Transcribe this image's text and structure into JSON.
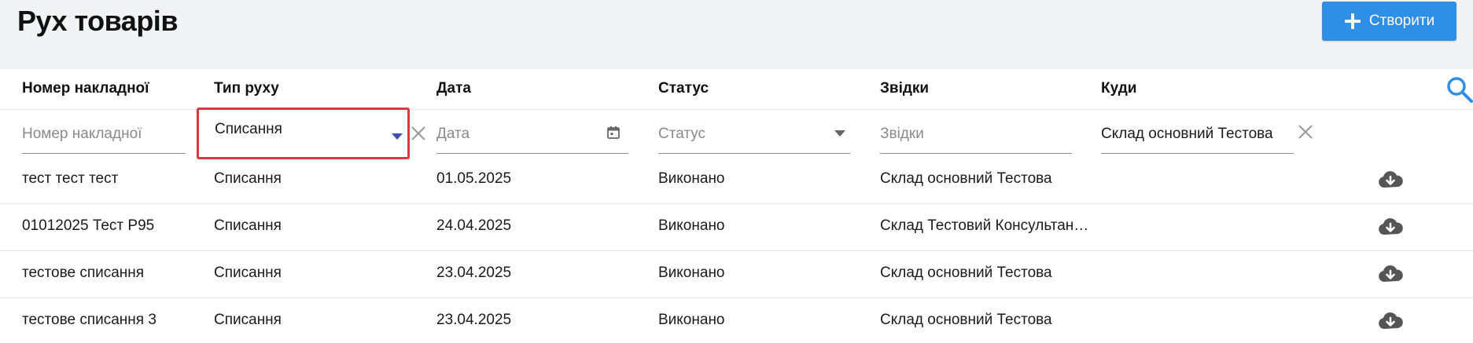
{
  "header": {
    "title": "Рух товарів",
    "create_label": "Створити"
  },
  "columns": [
    "Номер накладної",
    "Тип руху",
    "Дата",
    "Статус",
    "Звідки",
    "Куди"
  ],
  "filters": {
    "number_placeholder": "Номер накладної",
    "type_value": "Списання",
    "date_placeholder": "Дата",
    "status_placeholder": "Статус",
    "from_placeholder": "Звідки",
    "to_value": "Склад основний Тестова"
  },
  "rows": [
    {
      "number": "тест тест тест",
      "type": "Списання",
      "date": "01.05.2025",
      "status": "Виконано",
      "from": "Склад основний Тестова",
      "to": ""
    },
    {
      "number": "01012025 Тест Р95",
      "type": "Списання",
      "date": "24.04.2025",
      "status": "Виконано",
      "from": "Склад Тестовий Консультан…",
      "to": ""
    },
    {
      "number": "тестове списання",
      "type": "Списання",
      "date": "23.04.2025",
      "status": "Виконано",
      "from": "Склад основний Тестова",
      "to": ""
    },
    {
      "number": "тестове списання 3",
      "type": "Списання",
      "date": "23.04.2025",
      "status": "Виконано",
      "from": "Склад основний Тестова",
      "to": ""
    }
  ],
  "colors": {
    "accent": "#2f8ee5",
    "highlight_border": "#d9393f",
    "page_bg": "#f2f3f5"
  },
  "icons": [
    "plus-icon",
    "search-icon",
    "caret-down-icon",
    "clear-icon",
    "calendar-icon",
    "cloud-download-icon"
  ]
}
